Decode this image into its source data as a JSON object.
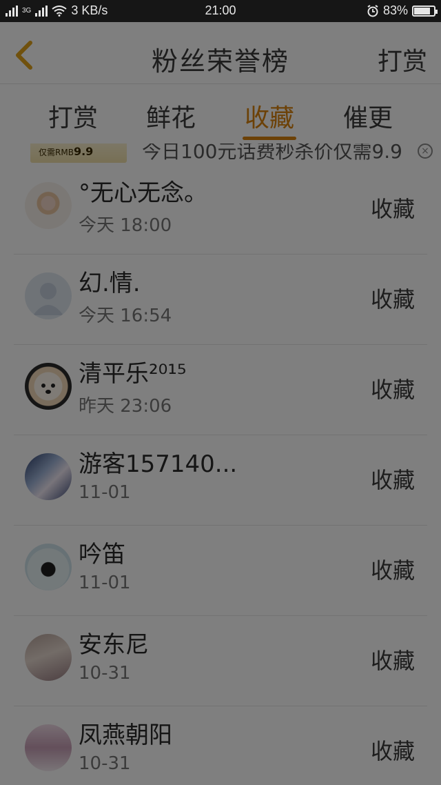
{
  "status_bar": {
    "network_speed": "3 KB/s",
    "network_label": "3G",
    "time": "21:00",
    "battery": "83%"
  },
  "header": {
    "title": "粉丝荣誉榜",
    "right_action": "打赏"
  },
  "tabs": [
    {
      "label": "打赏",
      "active": false
    },
    {
      "label": "鲜花",
      "active": false
    },
    {
      "label": "收藏",
      "active": true
    },
    {
      "label": "催更",
      "active": false
    }
  ],
  "banner": {
    "image_label": "仅需RMB",
    "image_price": "9.9",
    "text": "今日100元话费秒杀价仅需9.9"
  },
  "list": [
    {
      "name": "°无心无念。",
      "time": "今天 18:00",
      "action": "收藏",
      "avatar": "floral-avatar"
    },
    {
      "name": "幻.情.",
      "time": "今天 16:54",
      "action": "收藏",
      "avatar": "default-avatar"
    },
    {
      "name": "清平乐²⁰¹⁵",
      "time": "昨天 23:06",
      "action": "收藏",
      "avatar": "dog-avatar"
    },
    {
      "name": "游客157140...",
      "time": "11-01",
      "action": "收藏",
      "avatar": "anime-avatar"
    },
    {
      "name": "吟笛",
      "time": "11-01",
      "action": "收藏",
      "avatar": "cat-avatar"
    },
    {
      "name": "安东尼",
      "time": "10-31",
      "action": "收藏",
      "avatar": "photo-avatar"
    },
    {
      "name": "凤燕朝阳",
      "time": "10-31",
      "action": "收藏",
      "avatar": "girl-avatar"
    }
  ],
  "colors": {
    "accent": "#d9820e",
    "overlay": "rgba(0,0,0,0.5)"
  }
}
